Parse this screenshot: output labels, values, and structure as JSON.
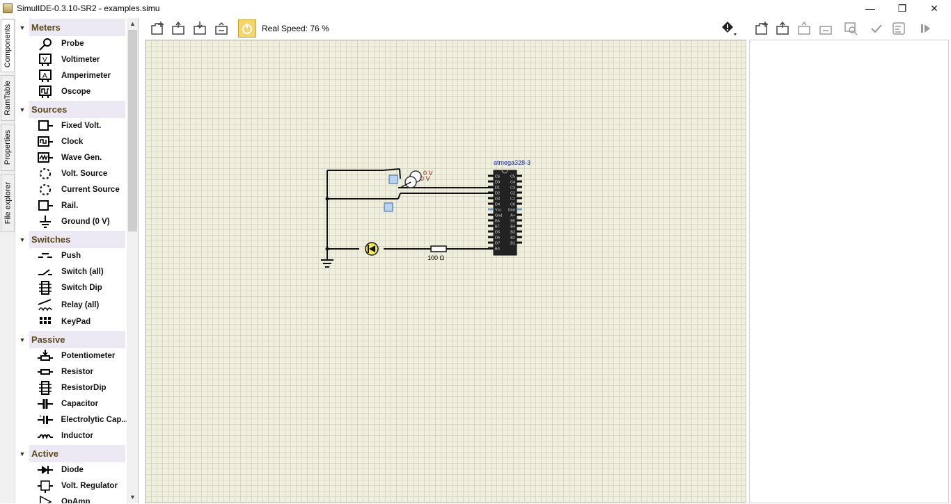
{
  "window": {
    "title": "SimulIDE-0.3.10-SR2  -  examples.simu",
    "controls": {
      "minimize": "—",
      "maximize": "❐",
      "close": "✕"
    }
  },
  "side_tabs": [
    "Components",
    "RamTable",
    "Properties",
    "File explorer"
  ],
  "categories": [
    {
      "label": "Meters",
      "items": [
        {
          "label": "Probe",
          "icon": "probe-icon"
        },
        {
          "label": "Voltimeter",
          "icon": "voltimeter-icon"
        },
        {
          "label": "Amperimeter",
          "icon": "amperimeter-icon"
        },
        {
          "label": "Oscope",
          "icon": "oscope-icon"
        }
      ]
    },
    {
      "label": "Sources",
      "items": [
        {
          "label": "Fixed Volt.",
          "icon": "fixed-volt-icon"
        },
        {
          "label": "Clock",
          "icon": "clock-icon"
        },
        {
          "label": "Wave Gen.",
          "icon": "wave-gen-icon"
        },
        {
          "label": "Volt. Source",
          "icon": "volt-source-icon"
        },
        {
          "label": "Current Source",
          "icon": "current-source-icon"
        },
        {
          "label": "Rail.",
          "icon": "rail-icon"
        },
        {
          "label": "Ground (0 V)",
          "icon": "ground-icon"
        }
      ]
    },
    {
      "label": "Switches",
      "items": [
        {
          "label": "Push",
          "icon": "push-icon"
        },
        {
          "label": "Switch (all)",
          "icon": "switch-icon"
        },
        {
          "label": "Switch Dip",
          "icon": "switch-dip-icon"
        },
        {
          "label": "Relay (all)",
          "icon": "relay-icon"
        },
        {
          "label": "KeyPad",
          "icon": "keypad-icon"
        }
      ]
    },
    {
      "label": "Passive",
      "items": [
        {
          "label": "Potentiometer",
          "icon": "potentiometer-icon"
        },
        {
          "label": "Resistor",
          "icon": "resistor-icon"
        },
        {
          "label": "ResistorDip",
          "icon": "resistor-dip-icon"
        },
        {
          "label": "Capacitor",
          "icon": "capacitor-icon"
        },
        {
          "label": "Electrolytic Cap...",
          "icon": "electrolytic-cap-icon"
        },
        {
          "label": "Inductor",
          "icon": "inductor-icon"
        }
      ]
    },
    {
      "label": "Active",
      "items": [
        {
          "label": "Diode",
          "icon": "diode-icon"
        },
        {
          "label": "Volt. Regulator",
          "icon": "volt-regulator-icon"
        },
        {
          "label": "OpAmp",
          "icon": "opamp-icon"
        }
      ]
    }
  ],
  "toolbar": {
    "speed_label": "Real Speed: 76 %"
  },
  "circuit": {
    "chip_label": "atmega328-3",
    "chip_pins_left": [
      "C6",
      "D0",
      "D1",
      "D2",
      "D3",
      "D4",
      "Vcc",
      "Gnd",
      "B6",
      "B7",
      "D5",
      "D6",
      "D7",
      "B0"
    ],
    "chip_pins_right": [
      "C5",
      "C4",
      "C3",
      "C2",
      "C1",
      "C0",
      "Gnd",
      "A+",
      "B5",
      "B4",
      "B3",
      "B2",
      "B1"
    ],
    "probe_value_1": "0 V",
    "probe_value_2": "0 V",
    "resistor_label": "100 Ω"
  }
}
